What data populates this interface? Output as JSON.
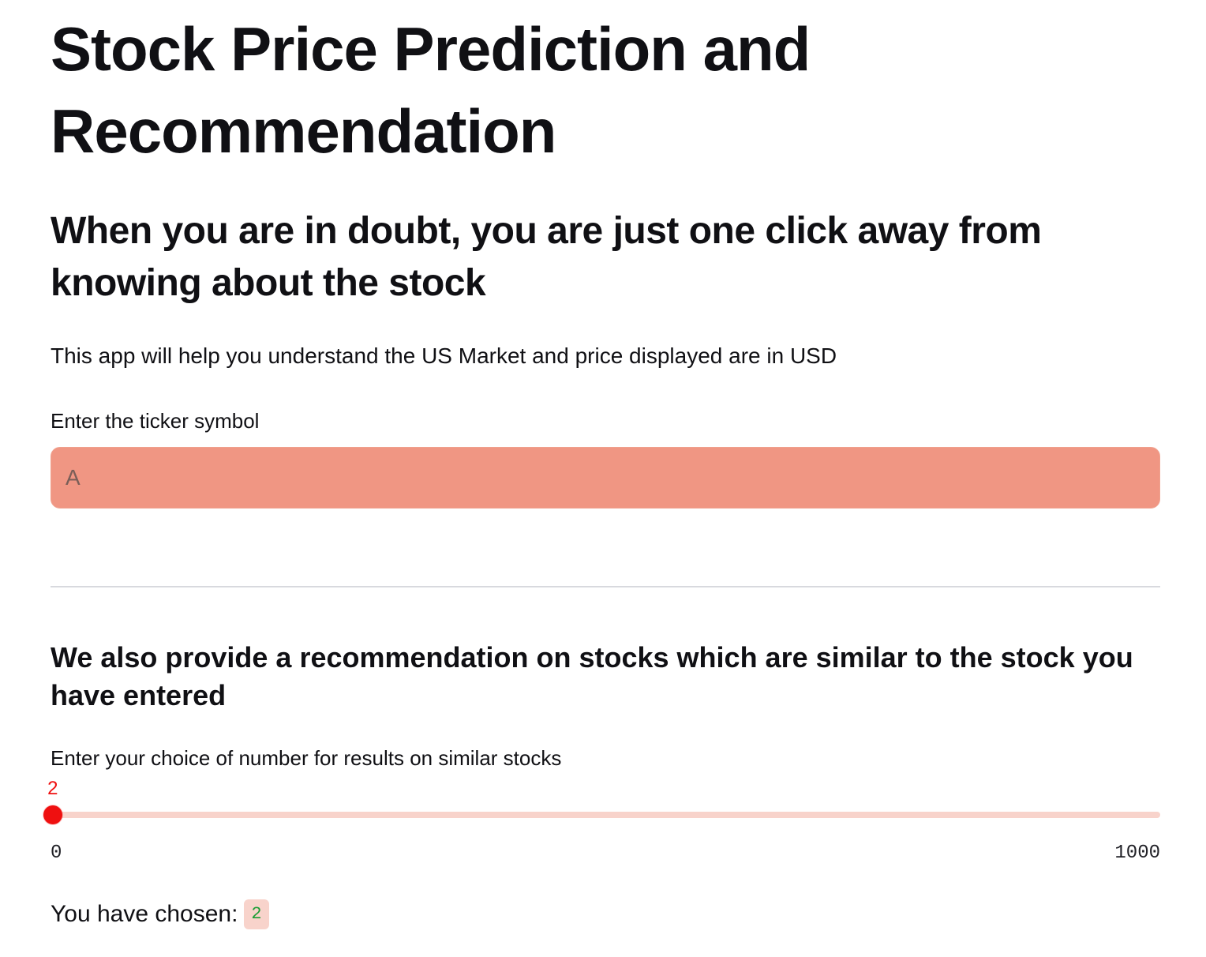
{
  "page": {
    "title": "Stock Price Prediction and Recommendation",
    "subtitle": "When you are in doubt, you are just one click away from knowing about the stock",
    "intro": "This app will help you understand the US Market and price displayed are in USD"
  },
  "ticker": {
    "label": "Enter the ticker symbol",
    "placeholder": "A",
    "value": ""
  },
  "recommendation": {
    "heading": "We also provide a recommendation on stocks which are similar to the stock you have entered",
    "slider_label": "Enter your choice of number for results on similar stocks",
    "value": "2",
    "min": "0",
    "max": "1000",
    "chosen_label": "You have chosen:",
    "chosen_value": "2"
  },
  "colors": {
    "accent": "#ef1010",
    "input_background": "#f09683",
    "slider_track": "#f8d3cb",
    "badge_text": "#1b9e35"
  }
}
